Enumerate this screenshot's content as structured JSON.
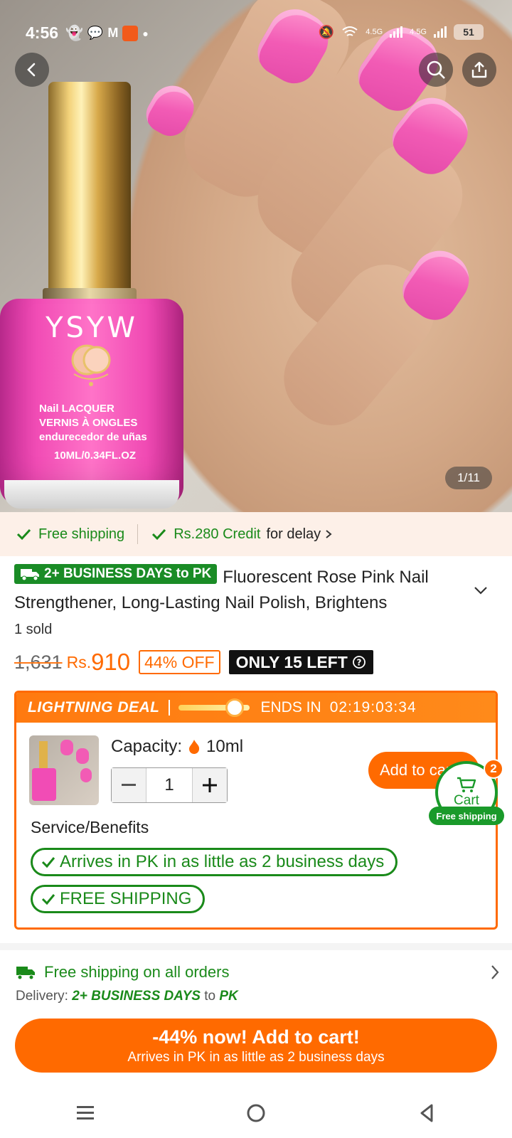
{
  "status_bar": {
    "time": "4:56",
    "network_1": "4.5G",
    "network_2": "4.5G",
    "battery": "51"
  },
  "gallery": {
    "counter": "1/11",
    "brand": "YSYW",
    "label_line1": "Nail LACQUER",
    "label_line2": "VERNIS À ONGLES",
    "label_line3": "endurecedor de uñas",
    "label_volume": "10ML/0.34FL.OZ"
  },
  "shipping_strip": {
    "free_shipping": "Free shipping",
    "credit": "Rs.280 Credit",
    "credit_suffix": "for delay"
  },
  "product": {
    "badge": "2+ BUSINESS DAYS to PK",
    "title": "Fluorescent Rose Pink Nail Strengthener, Long-Lasting Nail Polish, Brightens",
    "sold": "1 sold",
    "old_price": "1,631",
    "currency": "Rs.",
    "price": "910",
    "discount": "44% OFF",
    "stock": "ONLY 15 LEFT"
  },
  "deal": {
    "label": "LIGHTNING DEAL",
    "ends_label": "ENDS IN",
    "countdown": "02:19:03:34",
    "capacity_label": "Capacity:",
    "capacity_value": "10ml",
    "quantity": "1",
    "add_to_cart": "Add to cart",
    "service_label": "Service/Benefits",
    "benefit_1": "Arrives in PK in as little as 2 business days",
    "benefit_2": "FREE SHIPPING"
  },
  "cart_fab": {
    "label": "Cart",
    "count": "2",
    "badge": "Free shipping"
  },
  "shipping_info": {
    "title": "Free shipping on all orders",
    "delivery_label": "Delivery:",
    "delivery_days": "2+ BUSINESS DAYS",
    "delivery_to": "to",
    "delivery_country": "PK"
  },
  "cta": {
    "line1": "-44% now! Add to cart!",
    "line2": "Arrives in PK in as little as 2 business days"
  },
  "colors": {
    "accent": "#ff6a00",
    "green": "#1a8a1a",
    "pink": "#f14cb5"
  }
}
